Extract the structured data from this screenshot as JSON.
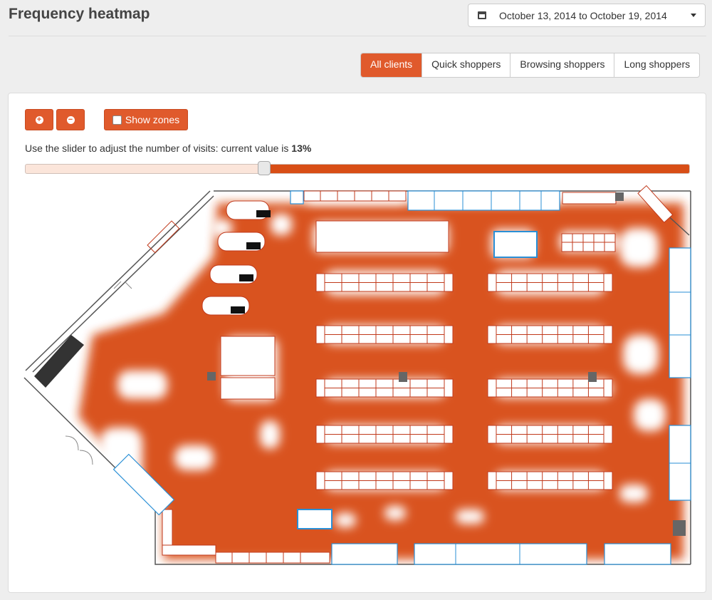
{
  "page": {
    "title": "Frequency heatmap"
  },
  "date_range": {
    "label": "October 13, 2014 to October 19, 2014"
  },
  "segments": [
    {
      "label": "All clients",
      "active": true
    },
    {
      "label": "Quick shoppers",
      "active": false
    },
    {
      "label": "Browsing shoppers",
      "active": false
    },
    {
      "label": "Long shoppers",
      "active": false
    }
  ],
  "toolbar": {
    "zoom_in_icon": "plus-circle-icon",
    "zoom_out_icon": "minus-circle-icon",
    "show_zones_label": "Show zones"
  },
  "slider": {
    "hint_prefix": "Use the slider to adjust the number of visits: current value is ",
    "value_label": "13%",
    "value": 0.36
  },
  "colors": {
    "accent": "#e05a2c",
    "heat": "#d84e16",
    "fixture_line": "#c0391b",
    "cooler_line": "#2a8fd6"
  }
}
